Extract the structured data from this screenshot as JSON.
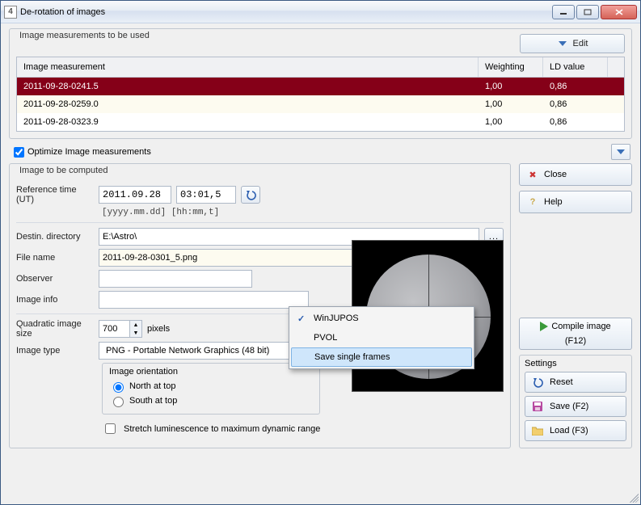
{
  "window": {
    "title": "De-rotation of images",
    "app_icon": "4"
  },
  "group1": {
    "title": "Image measurements to be used",
    "edit_label": "Edit",
    "columns": [
      "Image measurement",
      "Weighting",
      "LD value"
    ],
    "rows": [
      {
        "name": "2011-09-28-0241.5",
        "weighting": "1,00",
        "ld": "0,86",
        "selected": true
      },
      {
        "name": "2011-09-28-0259.0",
        "weighting": "1,00",
        "ld": "0,86",
        "selected": false
      },
      {
        "name": "2011-09-28-0323.9",
        "weighting": "1,00",
        "ld": "0,86",
        "selected": false
      }
    ],
    "optimize_label": "Optimize Image measurements",
    "optimize_checked": true
  },
  "group2": {
    "title": "Image to be computed",
    "ref_time_label": "Reference time (UT)",
    "ref_date": "2011.09.28",
    "ref_time": "03:01,5",
    "hint": "[yyyy.mm.dd] [hh:mm,t]",
    "dest_dir_label": "Destin. directory",
    "dest_dir": "E:\\Astro\\",
    "file_name_label": "File name",
    "file_name": "2011-09-28-0301_5.png",
    "observer_label": "Observer",
    "observer": "",
    "image_info_label": "Image info",
    "image_info": "",
    "quad_size_label": "Quadratic image size",
    "quad_size": "700",
    "pixels_label": "pixels",
    "image_type_label": "Image type",
    "image_type": "PNG  - Portable Network Graphics (48 bit)",
    "orientation_title": "Image orientation",
    "north_label": "North at top",
    "south_label": "South at top",
    "stretch_label": "Stretch luminescence to maximum dynamic range",
    "stretch_checked": false
  },
  "dropdown_menu": {
    "items": [
      "WinJUPOS",
      "PVOL",
      "Save single frames"
    ],
    "checked_index": 0,
    "highlighted_index": 2
  },
  "side": {
    "close": "Close",
    "help": "Help",
    "compile": "Compile image",
    "compile_key": "(F12)",
    "settings_title": "Settings",
    "reset": "Reset",
    "save": "Save (F2)",
    "load": "Load (F3)"
  },
  "colors": {
    "row_selected_bg": "#850018",
    "menu_highlight_bg": "#cfe6fb"
  }
}
